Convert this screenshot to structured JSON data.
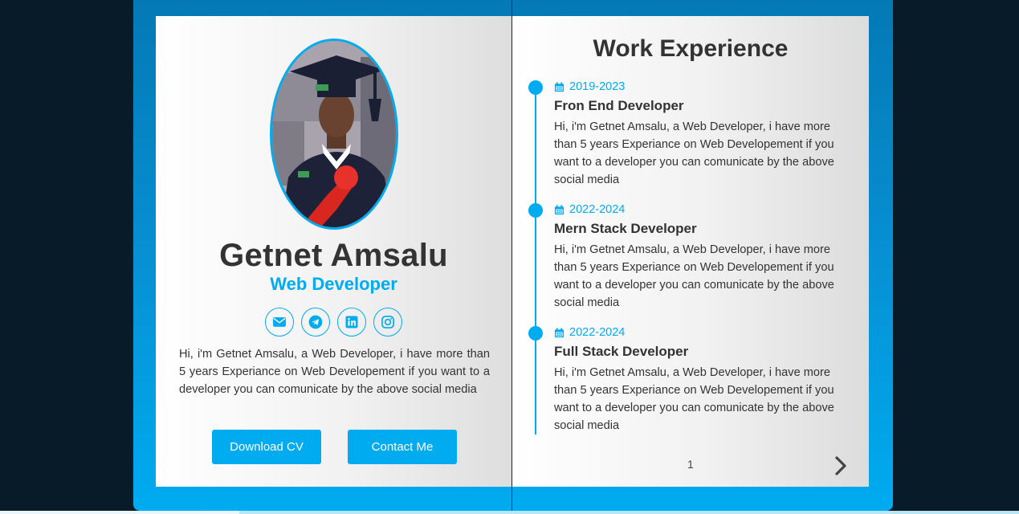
{
  "profile": {
    "name": "Getnet Amsalu",
    "role": "Web Developer",
    "bio": "Hi, i'm Getnet Amsalu, a Web Developer, i have more than 5 years Experiance on Web Developement if you want to a developer you can comunicate by the above social media",
    "socials": [
      {
        "icon": "envelope-icon"
      },
      {
        "icon": "telegram-icon"
      },
      {
        "icon": "linkedin-icon"
      },
      {
        "icon": "instagram-icon"
      }
    ],
    "buttons": {
      "download": "Download CV",
      "contact": "Contact Me"
    }
  },
  "experience": {
    "title": "Work Experience",
    "entries": [
      {
        "date": "2019-2023",
        "title": "Fron End Developer",
        "desc": "Hi, i'm Getnet Amsalu, a Web Developer, i have more than 5 years Experiance on Web Developement if you want to a developer you can comunicate by the above social media"
      },
      {
        "date": "2022-2024",
        "title": "Mern Stack Developer",
        "desc": "Hi, i'm Getnet Amsalu, a Web Developer, i have more than 5 years Experiance on Web Developement if you want to a developer you can comunicate by the above social media"
      },
      {
        "date": "2022-2024",
        "title": "Full Stack Developer",
        "desc": "Hi, i'm Getnet Amsalu, a Web Developer, i have more than 5 years Experiance on Web Developement if you want to a developer you can comunicate by the above social media"
      }
    ],
    "page_number": "1"
  },
  "colors": {
    "accent": "#00abf0",
    "background": "#081b29",
    "text": "#333333"
  }
}
